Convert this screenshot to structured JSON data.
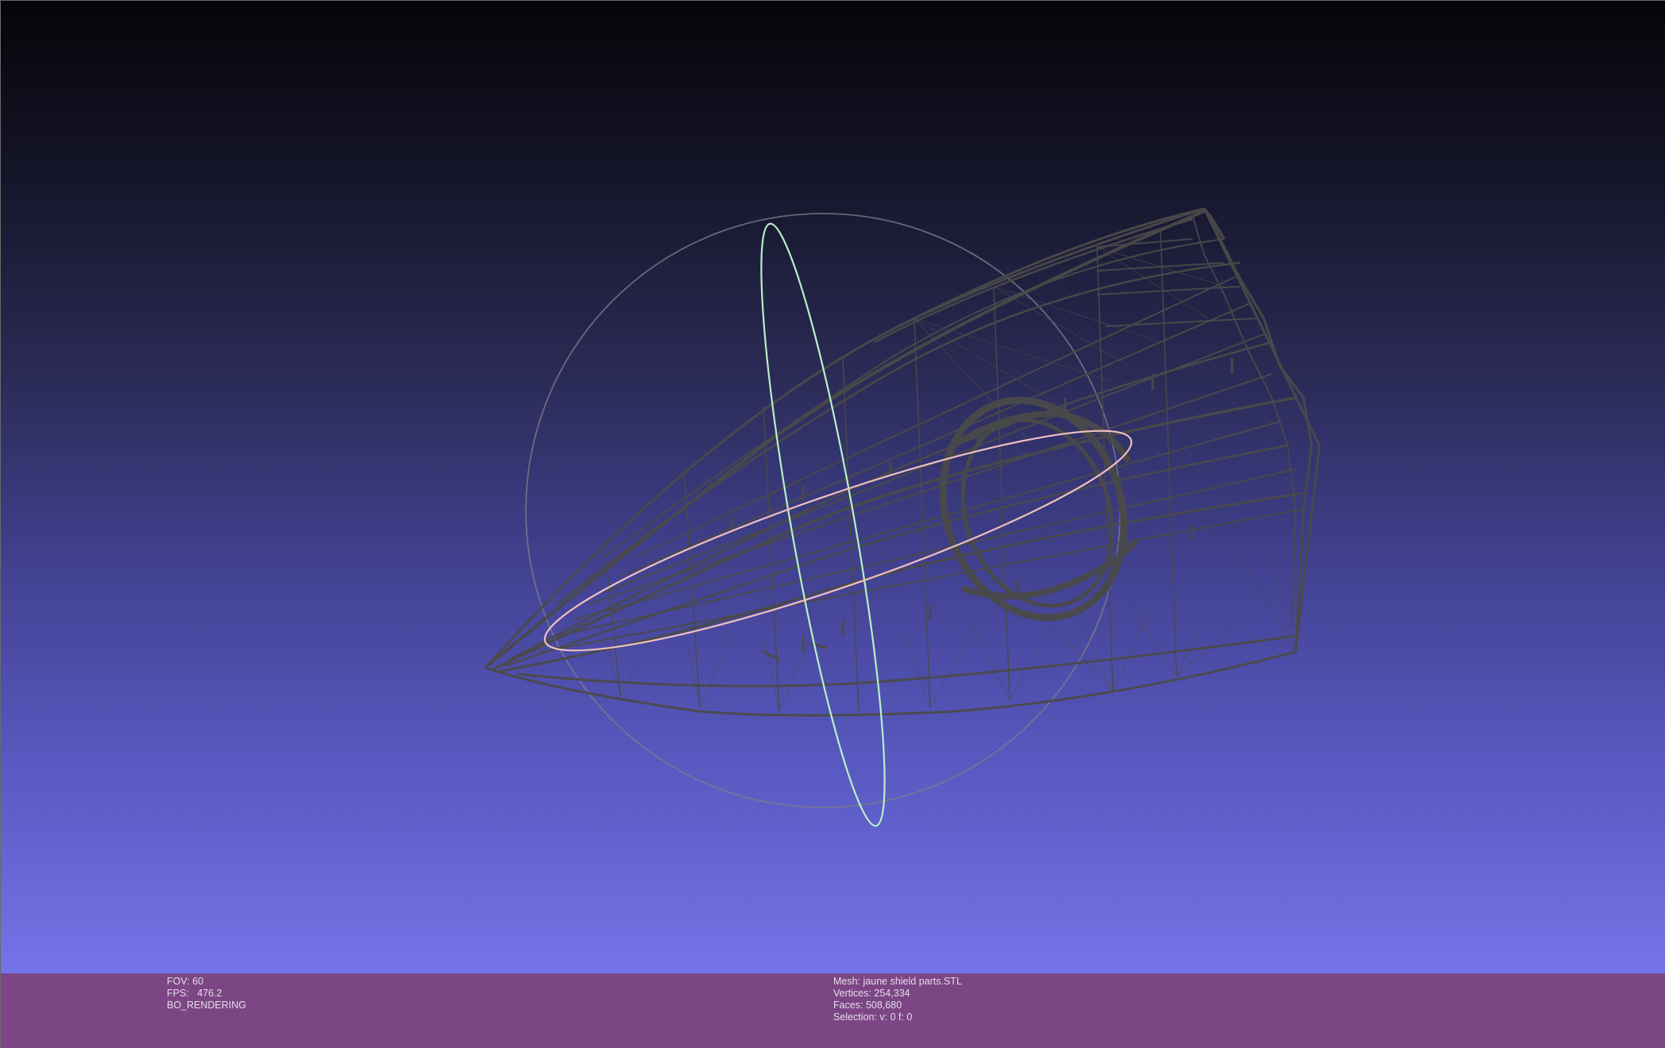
{
  "render_info": {
    "fov": "FOV: 60",
    "fps": "FPS:   476.2",
    "mode": "BO_RENDERING"
  },
  "mesh_info": {
    "mesh": "Mesh: jaune shield parts.STL",
    "vertices": "Vertices: 254,334",
    "faces": "Faces: 508,680",
    "selection": "Selection: v: 0 f: 0"
  },
  "colors": {
    "background_top": "#050509",
    "background_bottom": "#7474e8",
    "info_bar": "#7c4684",
    "wireframe": "#4a4a4a",
    "trackball_green": "#b8f0c8",
    "trackball_pink": "#f0c0c0",
    "trackball_gray": "#7a7a8a"
  }
}
